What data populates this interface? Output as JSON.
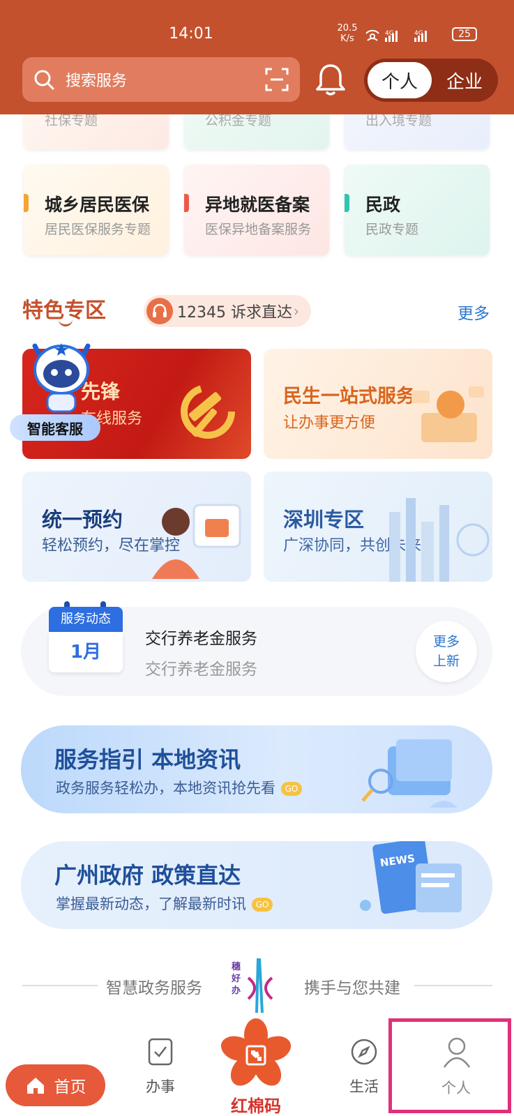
{
  "status_bar": {
    "time": "14:01",
    "speed_value": "20.5",
    "speed_unit": "K/s",
    "battery": "25"
  },
  "header": {
    "search_placeholder": "搜索服务",
    "toggle_personal": "个人",
    "toggle_enterprise": "企业"
  },
  "top_partial_cards": [
    "社保专题",
    "公积金专题",
    "出入境专题"
  ],
  "service_cards": [
    {
      "title": "城乡居民医保",
      "subtitle": "居民医保服务专题",
      "accent": "#f3a536"
    },
    {
      "title": "异地就医备案",
      "subtitle": "医保异地备案服务",
      "accent": "#ea5a4a"
    },
    {
      "title": "民政",
      "subtitle": "民政专题",
      "accent": "#2ec6b1"
    }
  ],
  "featured": {
    "title": "特色专区",
    "hotline": "12345 诉求直达",
    "more": "更多",
    "party_title": "先锋",
    "party_sub": "在线服务",
    "assistant_label": "智能客服",
    "banners": [
      {
        "title": "民生一站式服务",
        "subtitle": "让办事更方便"
      },
      {
        "title": "统一预约",
        "subtitle": "轻松预约，尽在掌控"
      },
      {
        "title": "深圳专区",
        "subtitle": "广深协同，共创未来"
      }
    ]
  },
  "news": {
    "calendar_label": "服务动态",
    "calendar_month": "1月",
    "title": "交行养老金服务",
    "subtitle": "交行养老金服务",
    "more_line1": "更多",
    "more_line2": "上新"
  },
  "promos": [
    {
      "title": "服务指引  本地资讯",
      "subtitle": "政务服务轻松办，本地资讯抢先看",
      "go": "GO"
    },
    {
      "title": "广州政府  政策直达",
      "subtitle": "掌握最新动态，了解最新时讯",
      "go": "GO"
    }
  ],
  "slogan": {
    "left": "智慧政务服务",
    "right": "携手与您共建",
    "logo_text": "穗好办"
  },
  "tabbar": {
    "home": "首页",
    "tasks": "办事",
    "center": "红棉码",
    "life": "生活",
    "profile": "个人"
  },
  "colors": {
    "brand": "#c3512d",
    "tab_active": "#e6593a",
    "link_blue": "#2b76cf",
    "highlight": "#e0307a"
  }
}
